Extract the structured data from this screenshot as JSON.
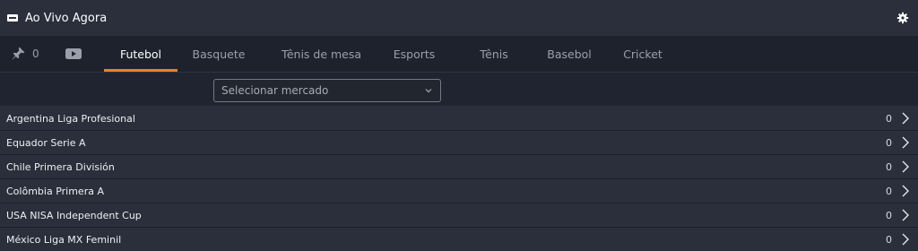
{
  "header": {
    "title": "Ao Vivo Agora",
    "settings_icon": "gear-icon"
  },
  "toolbar": {
    "pin_icon": "pin-icon",
    "pin_count": "0",
    "video_icon": "video-icon"
  },
  "tabs": [
    {
      "label": "Futebol",
      "active": true
    },
    {
      "label": "Basquete",
      "active": false
    },
    {
      "label": "Tênis de mesa",
      "active": false
    },
    {
      "label": "Esports",
      "active": false
    },
    {
      "label": "Tênis",
      "active": false
    },
    {
      "label": "Basebol",
      "active": false
    },
    {
      "label": "Cricket",
      "active": false
    }
  ],
  "market": {
    "placeholder": "Selecionar mercado"
  },
  "leagues": [
    {
      "name": "Argentina Liga Profesional",
      "count": "0"
    },
    {
      "name": "Equador Serie A",
      "count": "0"
    },
    {
      "name": "Chile Primera División",
      "count": "0"
    },
    {
      "name": "Colômbia Primera A",
      "count": "0"
    },
    {
      "name": "USA NISA Independent Cup",
      "count": "0"
    },
    {
      "name": "México Liga MX Feminil",
      "count": "0"
    }
  ],
  "colors": {
    "accent": "#f07d2a",
    "background": "#1f2430",
    "panel": "#2a2f3b"
  }
}
